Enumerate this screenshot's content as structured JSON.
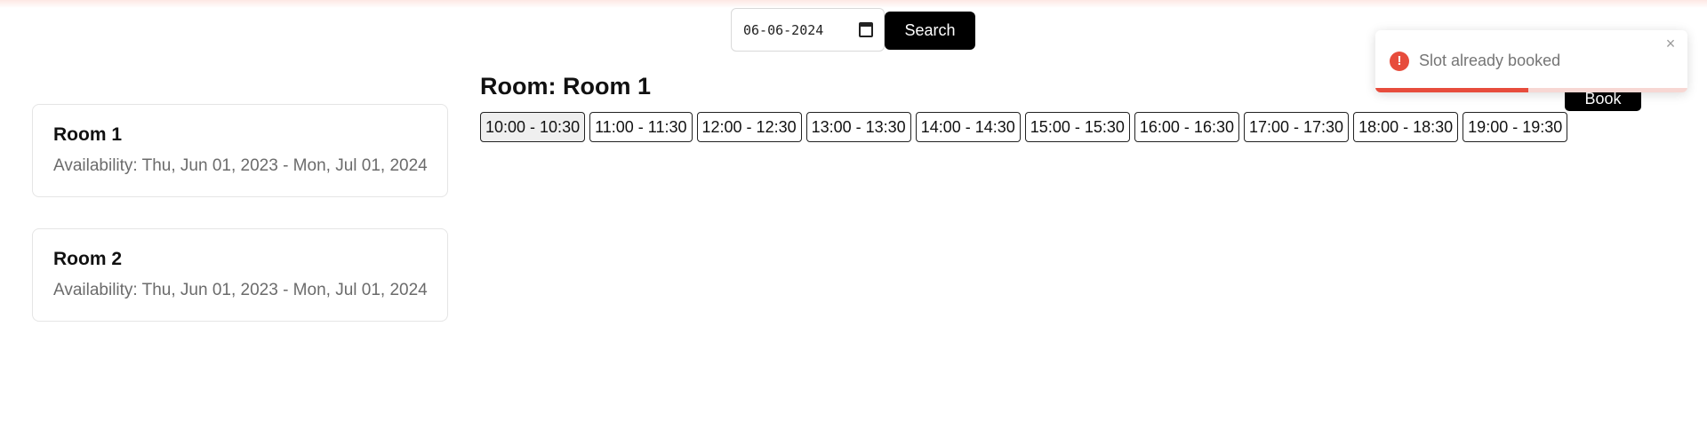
{
  "search": {
    "date_value": "06-06-2024",
    "button_label": "Search"
  },
  "rooms": [
    {
      "name": "Room 1",
      "availability": "Availability: Thu, Jun 01, 2023 - Mon, Jul 01, 2024"
    },
    {
      "name": "Room 2",
      "availability": "Availability: Thu, Jun 01, 2023 - Mon, Jul 01, 2024"
    }
  ],
  "main": {
    "title": "Room: Room 1",
    "book_label": "Book",
    "selected_slot": 0,
    "slots": [
      "10:00 - 10:30",
      "11:00 - 11:30",
      "12:00 - 12:30",
      "13:00 - 13:30",
      "14:00 - 14:30",
      "15:00 - 15:30",
      "16:00 - 16:30",
      "17:00 - 17:30",
      "18:00 - 18:30",
      "19:00 - 19:30"
    ]
  },
  "toast": {
    "icon": "error-icon",
    "icon_glyph": "!",
    "message": "Slot already booked",
    "close_glyph": "×",
    "progress": 0.49,
    "accent_color": "#e74c3c"
  },
  "colors": {
    "primary": "#000000",
    "error": "#e74c3c"
  }
}
